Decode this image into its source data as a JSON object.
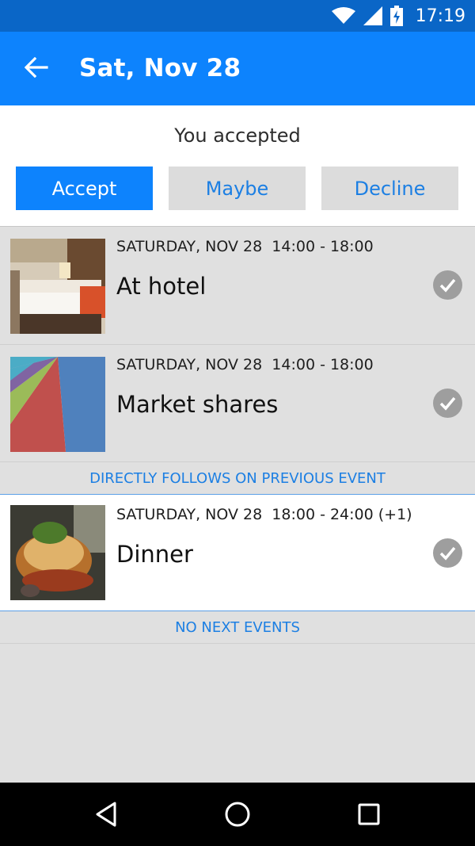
{
  "status_bar": {
    "time": "17:19",
    "icons": [
      "wifi-icon",
      "signal-icon",
      "battery-charging-icon"
    ]
  },
  "app_bar": {
    "title": "Sat, Nov 28",
    "back_icon": "arrow-left-icon"
  },
  "rsvp": {
    "status_text": "You accepted",
    "accept_label": "Accept",
    "maybe_label": "Maybe",
    "decline_label": "Decline",
    "selected": "Accept"
  },
  "events": [
    {
      "time": "SATURDAY, NOV 28  14:00 - 18:00",
      "title": "At hotel",
      "image": "hotel-room-photo",
      "status_icon": "check-circle-icon"
    },
    {
      "time": "SATURDAY, NOV 28  14:00 - 18:00",
      "title": "Market shares",
      "image": "pie-chart-image",
      "status_icon": "check-circle-icon"
    },
    {
      "time": "SATURDAY, NOV 28  18:00 - 24:00 (+1)",
      "title": "Dinner",
      "image": "dinner-food-photo",
      "status_icon": "check-circle-icon"
    }
  ],
  "separators": {
    "directly_follows": "DIRECTLY FOLLOWS ON PREVIOUS EVENT",
    "no_next": "NO NEXT EVENTS"
  },
  "nav_bar": {
    "icons": [
      "back-triangle-icon",
      "home-circle-icon",
      "recents-square-icon"
    ]
  },
  "colors": {
    "app_bar": "#0d83fd",
    "status_bar": "#0a66c7",
    "accent_text": "#1c7fe3",
    "background": "#e0e0e0"
  }
}
